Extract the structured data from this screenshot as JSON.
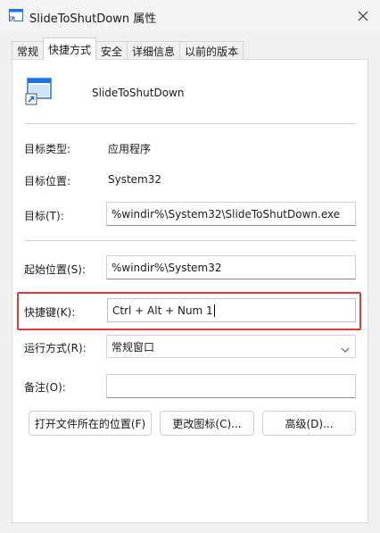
{
  "window": {
    "title": "SlideToShutDown 属性",
    "icon": "shortcut-window-icon"
  },
  "tabs": [
    {
      "label": "常规"
    },
    {
      "label": "快捷方式"
    },
    {
      "label": "安全"
    },
    {
      "label": "详细信息"
    },
    {
      "label": "以前的版本"
    }
  ],
  "active_tab": "快捷方式",
  "shortcut": {
    "name": "SlideToShutDown",
    "target_type_label": "目标类型:",
    "target_type_value": "应用程序",
    "target_location_label": "目标位置:",
    "target_location_value": "System32",
    "target_label": "目标(T):",
    "target_value": "%windir%\\System32\\SlideToShutDown.exe",
    "start_in_label": "起始位置(S):",
    "start_in_value": "%windir%\\System32",
    "hotkey_label": "快捷键(K):",
    "hotkey_value": "Ctrl + Alt + Num 1",
    "run_label": "运行方式(R):",
    "run_value": "常规窗口",
    "comment_label": "备注(O):",
    "comment_value": ""
  },
  "buttons": {
    "open_location": "打开文件所在的位置(F)",
    "change_icon": "更改图标(C)...",
    "advanced": "高级(D)..."
  },
  "colors": {
    "highlight": "#e0393b",
    "icon_blue": "#1a73e8"
  }
}
